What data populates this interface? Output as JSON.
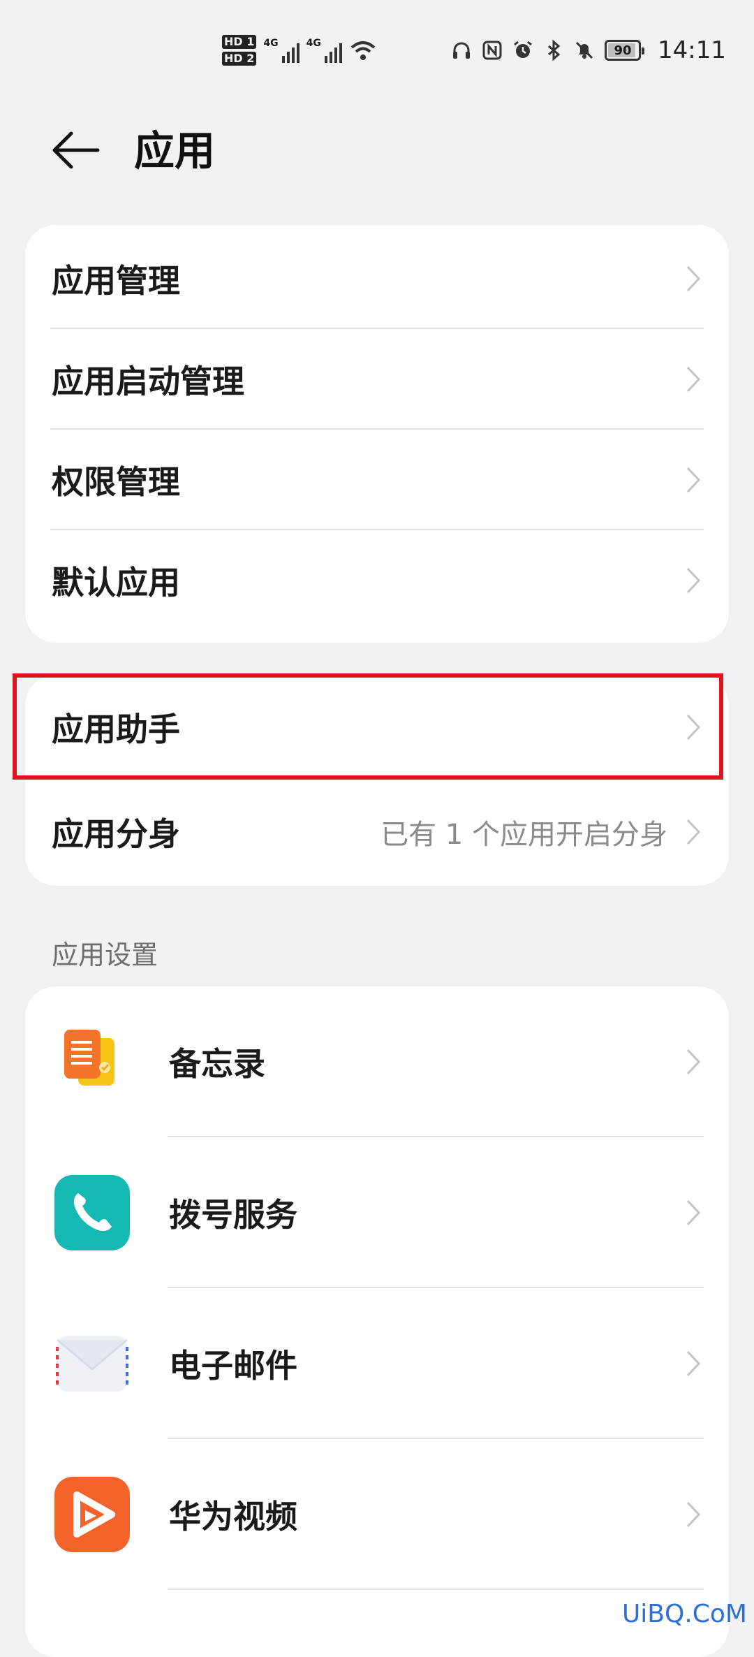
{
  "status_bar": {
    "hd1": "HD 1",
    "hd2": "HD 2",
    "net1": "4G",
    "net2": "4G",
    "icons": [
      "headphones-icon",
      "nfc-icon",
      "alarm-icon",
      "bluetooth-icon",
      "mute-icon"
    ],
    "battery": "90",
    "time": "14:11"
  },
  "header": {
    "title": "应用"
  },
  "group1": {
    "items": [
      {
        "label": "应用管理"
      },
      {
        "label": "应用启动管理"
      },
      {
        "label": "权限管理"
      },
      {
        "label": "默认应用"
      }
    ]
  },
  "group2": {
    "items": [
      {
        "label": "应用助手",
        "value": ""
      },
      {
        "label": "应用分身",
        "value": "已有 1 个应用开启分身"
      }
    ]
  },
  "section": {
    "title": "应用设置"
  },
  "apps": {
    "items": [
      {
        "label": "备忘录",
        "icon": "notes-app-icon"
      },
      {
        "label": "拨号服务",
        "icon": "phone-app-icon"
      },
      {
        "label": "电子邮件",
        "icon": "email-app-icon"
      },
      {
        "label": "华为视频",
        "icon": "video-app-icon"
      }
    ]
  },
  "watermark": "UiBQ.CoM",
  "colors": {
    "highlight": "#e0141e",
    "background": "#f1f2f4"
  }
}
